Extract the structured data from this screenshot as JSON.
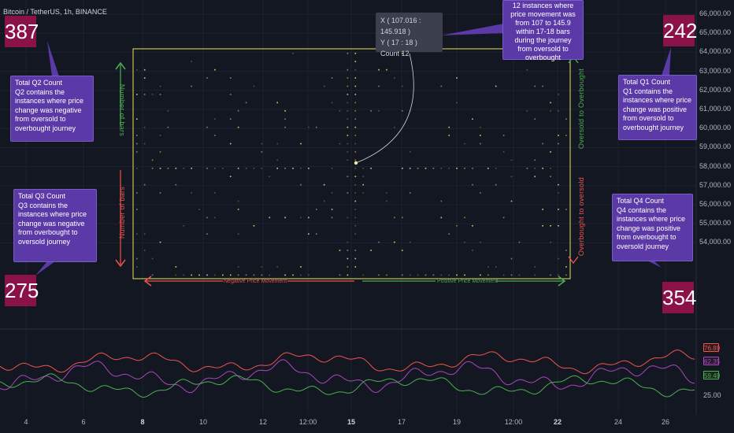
{
  "symbol": "Bitcoin / TetherUS, 1h, BINANCE",
  "y_axis": [
    "66,000.00",
    "65,000.00",
    "64,000.00",
    "63,000.00",
    "62,000.00",
    "61,000.00",
    "60,000.00",
    "59,000.00",
    "58,000.00",
    "57,000.00",
    "56,000.00",
    "55,000.00",
    "54,000.00"
  ],
  "x_axis": [
    {
      "label": "4",
      "bold": false
    },
    {
      "label": "6",
      "bold": false
    },
    {
      "label": "8",
      "bold": true
    },
    {
      "label": "10",
      "bold": false
    },
    {
      "label": "12",
      "bold": false
    },
    {
      "label": "12:00",
      "bold": false
    },
    {
      "label": "15",
      "bold": true
    },
    {
      "label": "17",
      "bold": false
    },
    {
      "label": "19",
      "bold": false
    },
    {
      "label": "12:00",
      "bold": false
    },
    {
      "label": "22",
      "bold": true
    },
    {
      "label": "24",
      "bold": false
    },
    {
      "label": "26",
      "bold": false
    }
  ],
  "quadrants": {
    "q1": {
      "count": "242",
      "title": "Total Q1 Count",
      "desc": "Q1 contains the instances where price change was positive from oversold to overbought journey"
    },
    "q2": {
      "count": "387",
      "title": "Total Q2 Count",
      "desc": "Q2 contains the  instances where price change was negative from oversold to overbought journey"
    },
    "q3": {
      "count": "275",
      "title": "Total Q3 Count",
      "desc": "Q3 contains the instances where price change was negative from overbought to oversold journey"
    },
    "q4": {
      "count": "354",
      "title": "Total Q4 Count",
      "desc": "Q4 contains the instances where price change was positive from overbought to oversold journey"
    }
  },
  "tooltip": {
    "x": "X ( 107.016 : 145.918 )",
    "y": "Y ( 17 : 18 )",
    "count": "Count 12"
  },
  "callout": "12 instances where price movement was from 107 to 145.9 within 17-18 bars during the journey from oversold to overbought",
  "axis_labels": {
    "left_bars": "Number of bars",
    "right_top": "Oversold to Overbought",
    "right_bottom": "Overbought to oversold",
    "neg_move": "Negative Price Movement",
    "pos_move": "Positive Price Movement"
  },
  "indicator": {
    "values": [
      "76.89",
      "62.35",
      "59.40"
    ],
    "y_axis": [
      "25.00"
    ],
    "colors": {
      "upper": "#ef5350",
      "middle": "#ab47bc",
      "lower": "#4caf50"
    }
  },
  "colors": {
    "grid_yellow": "#e8e35a",
    "up_green": "#4caf50",
    "down_red": "#ef5350",
    "count_bg": "#8b1249",
    "note_bg": "#5b3aa8"
  }
}
